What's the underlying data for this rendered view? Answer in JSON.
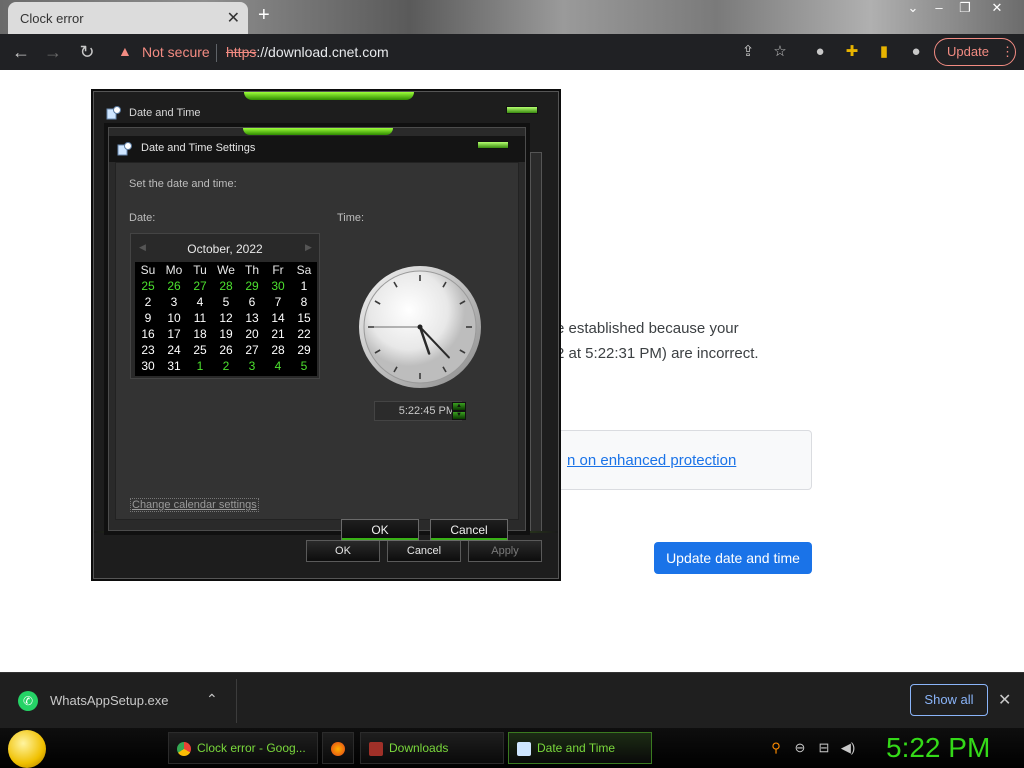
{
  "browser": {
    "tab_title": "Clock error",
    "tab_close": "✕",
    "new_tab": "+",
    "not_secure": "Not secure",
    "url_scheme": "https",
    "url_rest": "://download.cnet.com",
    "update_label": "Update"
  },
  "page": {
    "body_line_1": "e established because your",
    "body_line_2": "2 at 5:22:31 PM) are incorrect.",
    "protection_link": "n on enhanced protection",
    "update_button": "Update date and time"
  },
  "outer_dialog": {
    "title": "Date and Time",
    "ok": "OK",
    "cancel": "Cancel",
    "apply": "Apply"
  },
  "inner_dialog": {
    "title": "Date and Time Settings",
    "instruction": "Set the date and time:",
    "date_label": "Date:",
    "time_label": "Time:",
    "month_year": "October, 2022",
    "weekdays": [
      "Su",
      "Mo",
      "Tu",
      "We",
      "Th",
      "Fr",
      "Sa"
    ],
    "weeks": [
      [
        {
          "d": "25",
          "o": true
        },
        {
          "d": "26",
          "o": true
        },
        {
          "d": "27",
          "o": true
        },
        {
          "d": "28",
          "o": true
        },
        {
          "d": "29",
          "o": true
        },
        {
          "d": "30",
          "o": true
        },
        {
          "d": "1",
          "o": false
        }
      ],
      [
        {
          "d": "2",
          "o": false
        },
        {
          "d": "3",
          "o": false
        },
        {
          "d": "4",
          "o": false
        },
        {
          "d": "5",
          "o": false
        },
        {
          "d": "6",
          "o": false
        },
        {
          "d": "7",
          "o": false
        },
        {
          "d": "8",
          "o": false
        }
      ],
      [
        {
          "d": "9",
          "o": false
        },
        {
          "d": "10",
          "o": false
        },
        {
          "d": "11",
          "o": false
        },
        {
          "d": "12",
          "o": false
        },
        {
          "d": "13",
          "o": false
        },
        {
          "d": "14",
          "o": false
        },
        {
          "d": "15",
          "o": false
        }
      ],
      [
        {
          "d": "16",
          "o": false
        },
        {
          "d": "17",
          "o": false
        },
        {
          "d": "18",
          "o": false
        },
        {
          "d": "19",
          "o": false
        },
        {
          "d": "20",
          "o": false
        },
        {
          "d": "21",
          "o": false
        },
        {
          "d": "22",
          "o": false
        }
      ],
      [
        {
          "d": "23",
          "o": false
        },
        {
          "d": "24",
          "o": false
        },
        {
          "d": "25",
          "o": false
        },
        {
          "d": "26",
          "o": false
        },
        {
          "d": "27",
          "o": false
        },
        {
          "d": "28",
          "o": false
        },
        {
          "d": "29",
          "o": false
        }
      ],
      [
        {
          "d": "30",
          "o": false
        },
        {
          "d": "31",
          "o": false
        },
        {
          "d": "1",
          "o": true
        },
        {
          "d": "2",
          "o": true
        },
        {
          "d": "3",
          "o": true
        },
        {
          "d": "4",
          "o": true
        },
        {
          "d": "5",
          "o": true
        }
      ]
    ],
    "time_value": "5:22:45 PM",
    "clock": {
      "hour": 5,
      "minute": 22,
      "second": 45
    },
    "calendar_settings_link": "Change calendar settings",
    "ok": "OK",
    "cancel": "Cancel"
  },
  "download_bar": {
    "file_name": "WhatsAppSetup.exe",
    "show_all": "Show all",
    "close": "✕"
  },
  "taskbar": {
    "items": [
      {
        "label": "Clock error - Goog..."
      },
      {
        "label": "Downloads"
      },
      {
        "label": "Date and Time"
      }
    ],
    "clock": "5:22 PM"
  },
  "colors": {
    "accent_green": "#4ce12e",
    "chrome_blue": "#1a73e8",
    "warning_red": "#f28b82"
  }
}
